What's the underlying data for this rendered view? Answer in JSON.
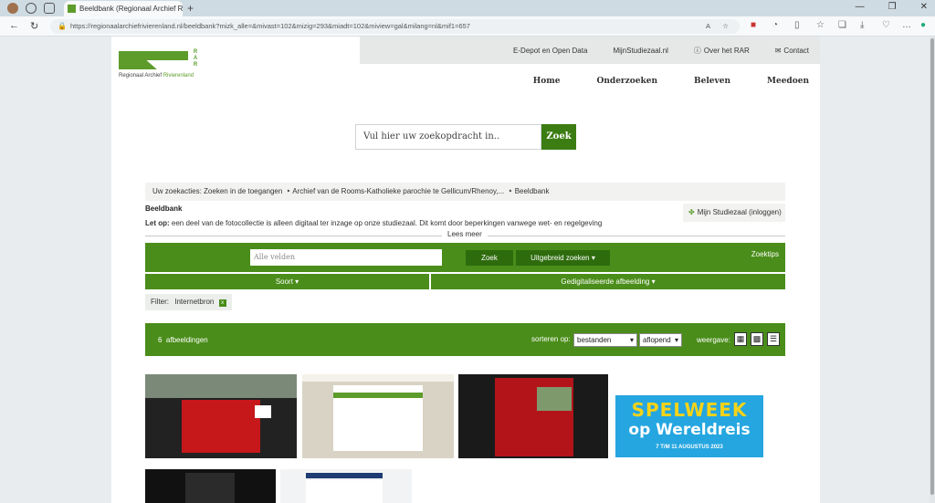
{
  "browser": {
    "tab_title": "Beeldbank (Regionaal Archief Riv",
    "url": "https://regionaalarchiefrivierenland.nl/beeldbank?mizk_alle=&mivast=102&mizig=293&miadt=102&miview=gal&milang=nl&mif1=657"
  },
  "topbar": {
    "link1": "E-Depot en Open Data",
    "link2": "MijnStudiezaal.nl",
    "link3": "Over het RAR",
    "link4": "Contact"
  },
  "logo": {
    "letters": [
      "R",
      "A",
      "R"
    ],
    "name_part1": "Regionaal Archief ",
    "name_part2": "Rivierenland"
  },
  "mainnav": {
    "items": [
      "Home",
      "Onderzoeken",
      "Beleven",
      "Meedoen"
    ]
  },
  "search": {
    "placeholder": "Vul hier uw zoekopdracht in..",
    "button": "Zoek"
  },
  "breadcrumb": {
    "prefix": "Uw zoekacties:",
    "items": [
      "Zoeken in de toegangen",
      "Archief van de Rooms-Katholieke parochie te Gellicum/Rhenoy,...",
      "Beeldbank"
    ]
  },
  "section": {
    "title": "Beeldbank",
    "notice_bold": "Let op:",
    "notice_text": " een deel van de fotocollectie is alleen digitaal ter inzage op onze studiezaal. Dit komt door beperkingen vanwege wet- en regelgeving",
    "lees_meer": "Lees meer",
    "studiezaal": "Mijn Studiezaal (inloggen)"
  },
  "searchbar": {
    "placeholder": "Alle velden",
    "zoek": "Zoek",
    "uitgebreid": "Uitgebreid zoeken",
    "tips": "Zoektips"
  },
  "facets": {
    "soort": "Soort",
    "gedigitaliseerd": "Gedigitaliseerde afbeelding"
  },
  "filter": {
    "label": "Filter:",
    "tag": "Internetbron",
    "remove": "x"
  },
  "results": {
    "count": "6",
    "count_label": "afbeeldingen",
    "sort_label": "sorteren op:",
    "sort_value": "bestanden",
    "order_value": "aflopend",
    "view_label": "weergave:"
  },
  "thumbnails": {
    "spelweek_line1": "SPELWEEK",
    "spelweek_line2": "op Wereldreis",
    "spelweek_date": "7 T/M 11 AUGUSTUS 2023"
  }
}
